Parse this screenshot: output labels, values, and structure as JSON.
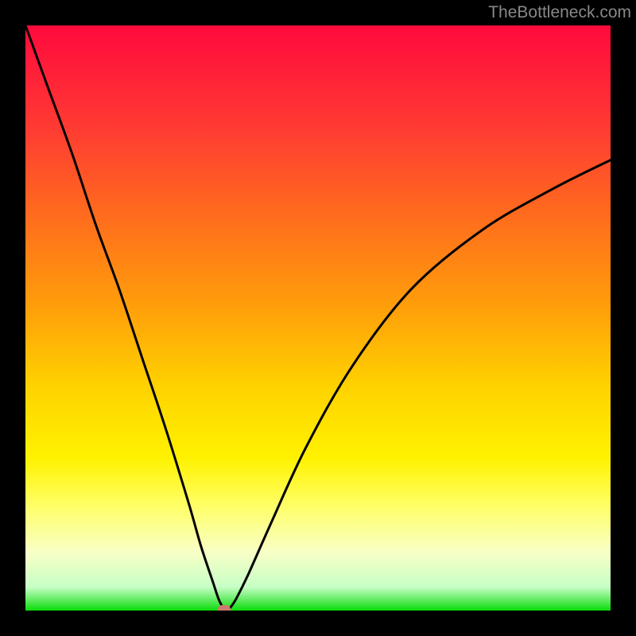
{
  "watermark": "TheBottleneck.com",
  "chart_data": {
    "type": "line",
    "title": "",
    "xlabel": "",
    "ylabel": "",
    "xlim": [
      0,
      100
    ],
    "ylim": [
      0,
      100
    ],
    "grid": false,
    "series": [
      {
        "name": "bottleneck-curve",
        "x": [
          0,
          4,
          8,
          12,
          16,
          20,
          24,
          28,
          30,
          32,
          33,
          33.8,
          34.5,
          35,
          36,
          38,
          42,
          48,
          56,
          66,
          78,
          90,
          100
        ],
        "y": [
          100,
          89,
          78,
          66,
          55,
          43,
          31,
          18,
          11,
          5,
          2,
          0.5,
          0.2,
          0.5,
          2,
          6,
          15,
          28,
          42,
          55,
          65,
          72,
          77
        ]
      }
    ],
    "annotations": [
      {
        "name": "optimum-marker",
        "x": 34,
        "y": 0.2
      }
    ],
    "background": "rainbow-vertical"
  }
}
